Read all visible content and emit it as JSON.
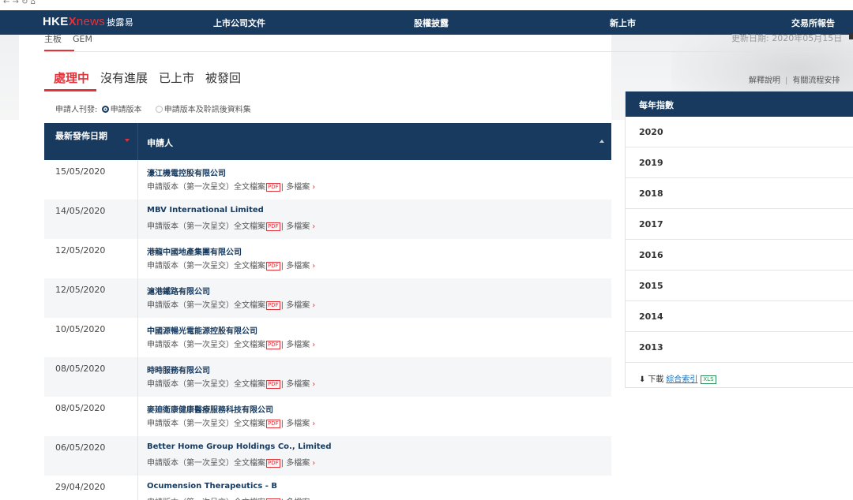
{
  "browser": {
    "controls": "←  →  ↻  ⌂"
  },
  "header": {
    "logo_hkex": "HKE",
    "logo_x": "X",
    "logo_news": "news",
    "logo_sub": "披露易",
    "nav": [
      "上市公司文件",
      "股權披露",
      "新上市",
      "交易所報告"
    ]
  },
  "boards": {
    "items": [
      "主板",
      "GEM"
    ],
    "active": 0
  },
  "update_text": "更新日期: 2020年05月15日",
  "status_tabs": [
    "處理中",
    "沒有進展",
    "已上市",
    "被發回"
  ],
  "links": {
    "explain": "解釋說明",
    "process": "有關流程安排"
  },
  "filter": {
    "label": "申請人刊發:",
    "option1": "申請版本",
    "option2": "申請版本及聆訊後資料集",
    "selected": "申請版本"
  },
  "table": {
    "col_date": "最新發佈日期",
    "col_applicant": "申請人",
    "version_text": "申請版本（第一次呈交）全文檔案",
    "pdf_badge": "PDF",
    "multi_text": "| 多檔案",
    "chevron": "›",
    "rows": [
      {
        "date": "15/05/2020",
        "name": "濠江機電控股有限公司"
      },
      {
        "date": "14/05/2020",
        "name": "MBV International Limited"
      },
      {
        "date": "12/05/2020",
        "name": "港龍中國地產集團有限公司"
      },
      {
        "date": "12/05/2020",
        "name": "滬港鐵路有限公司"
      },
      {
        "date": "10/05/2020",
        "name": "中國源暢光電能源控股有限公司"
      },
      {
        "date": "08/05/2020",
        "name": "時時服務有限公司"
      },
      {
        "date": "08/05/2020",
        "name": "麥廸衛康健康醫療服務科技有限公司"
      },
      {
        "date": "06/05/2020",
        "name": "Better Home Group Holdings Co., Limited"
      },
      {
        "date": "29/04/2020",
        "name": "Ocumension Therapeutics - B"
      }
    ]
  },
  "sidebar": {
    "title": "每年指數",
    "years": [
      "2020",
      "2019",
      "2018",
      "2017",
      "2016",
      "2015",
      "2014",
      "2013"
    ],
    "download_label": "下載",
    "download_link": "綜合索引",
    "xls_badge": "XLS"
  },
  "colors": {
    "navy": "#173a5e",
    "accent_red": "#e2333b",
    "link_blue": "#1a6fb5"
  }
}
